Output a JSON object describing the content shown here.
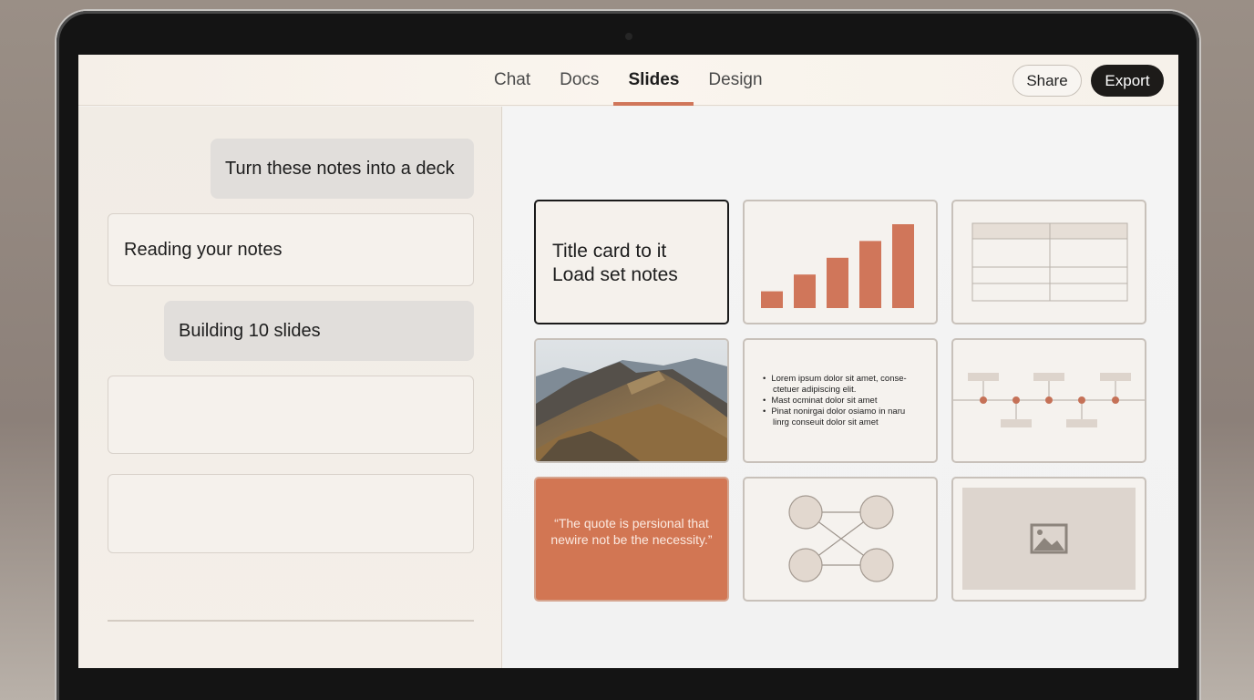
{
  "topbar": {
    "tabs": [
      {
        "label": "Chat",
        "active": false
      },
      {
        "label": "Docs",
        "active": false
      },
      {
        "label": "Slides",
        "active": true
      },
      {
        "label": "Design",
        "active": false
      }
    ],
    "share_label": "Share",
    "export_label": "Export"
  },
  "chat": {
    "messages": [
      {
        "role": "user",
        "text": "Turn these notes into a deck"
      },
      {
        "role": "assistant",
        "text": "Reading your notes"
      },
      {
        "role": "user",
        "text": "Building 10 slides"
      },
      {
        "role": "assistant",
        "text": ""
      },
      {
        "role": "assistant",
        "text": ""
      }
    ]
  },
  "slides": {
    "title_card": {
      "line1": "Title card to it",
      "line2": "Load set notes"
    },
    "bar_chart_values": [
      1,
      2,
      3,
      4,
      5
    ],
    "bullets": [
      "Lorem ipsum dolor sit amet, conse-",
      "ctetuer adipiscing elit.",
      "Mast ocminat dolor sit amet",
      "Pinat nonirgai dolor osiamo in naru",
      "linrg conseuit dolor sit amet"
    ],
    "quote": "“The quote is persional that newire not be the necessity.”",
    "icons": {
      "image": "image-icon"
    }
  },
  "colors": {
    "accent": "#d0765a",
    "export_bg": "#1d1b19",
    "quote_bg": "#d27653"
  }
}
